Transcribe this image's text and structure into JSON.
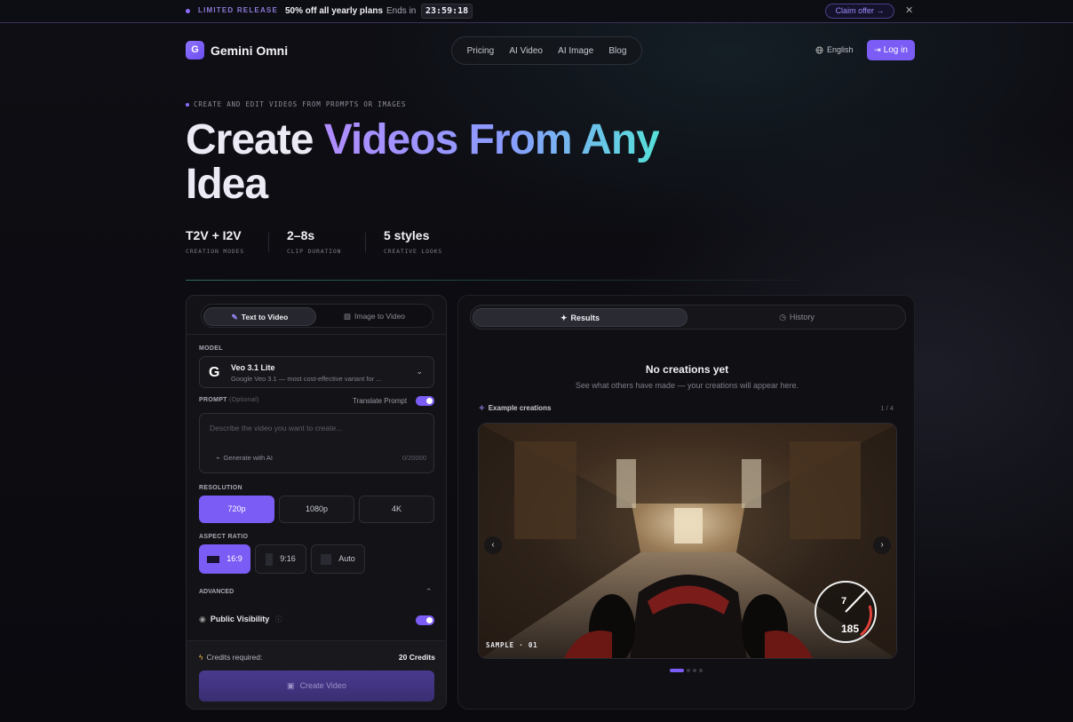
{
  "promo": {
    "tag": "LIMITED RELEASE",
    "offer": "50% off all yearly plans",
    "sep": "·",
    "ends": "Ends in",
    "timer": "23:59:18",
    "claim": "Claim offer →",
    "close": "✕"
  },
  "nav": {
    "logo_letter": "G",
    "brand": "Gemini Omni",
    "links": [
      "Pricing",
      "AI Video",
      "AI Image",
      "Blog"
    ],
    "language": "English",
    "login": "Log in"
  },
  "hero": {
    "eyebrow": "CREATE AND EDIT VIDEOS FROM PROMPTS OR IMAGES",
    "title_plain": "Create ",
    "title_gradient": "Videos From Any",
    "title_line2": "Idea",
    "stats": [
      {
        "value": "T2V + I2V",
        "label": "CREATION MODES"
      },
      {
        "value": "2–8s",
        "label": "CLIP DURATION"
      },
      {
        "value": "5 styles",
        "label": "CREATIVE LOOKS"
      }
    ]
  },
  "left": {
    "tab_active": "Text to Video",
    "tab_inactive": "Image to Video",
    "model_label": "MODEL",
    "model_name": "Veo 3.1 Lite",
    "model_desc": "Google Veo 3.1 — most cost-effective variant for ...",
    "prompt_label": "PROMPT",
    "prompt_optional": "(Optional)",
    "translate": "Translate Prompt",
    "prompt_placeholder": "Describe the video you want to create...",
    "generate_ai": "Generate with AI",
    "char_count": "0/20000",
    "resolution_label": "RESOLUTION",
    "resolutions": [
      "720p",
      "1080p",
      "4K"
    ],
    "selected_resolution": "720p",
    "aspect_label": "ASPECT RATIO",
    "ratios": [
      "16:9",
      "9:16",
      "Auto"
    ],
    "selected_ratio": "16:9",
    "advanced": "ADVANCED",
    "public_visibility": "Public Visibility",
    "credits_label": "Credits required:",
    "credits_value": "20 Credits",
    "create_button": "Create Video"
  },
  "right": {
    "tab_active": "Results",
    "tab_inactive": "History",
    "empty_title": "No creations yet",
    "empty_sub": "See what others have made — your creations will appear here.",
    "examples_label": "Example creations",
    "page_counter": "1 / 4",
    "sample_label": "SAMPLE · 01",
    "gear": "7",
    "speed": "185",
    "active_slide": 1,
    "slide_count": 4
  },
  "colors": {
    "accent": "#7b5cf5",
    "background": "#0b0b10",
    "panel": "#131317"
  }
}
